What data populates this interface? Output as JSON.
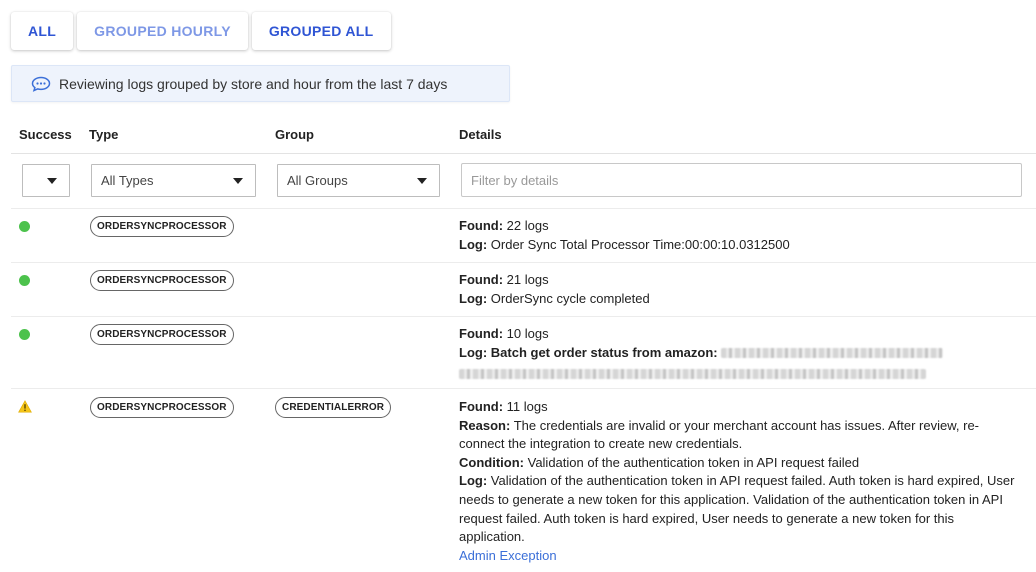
{
  "tabs": [
    {
      "label": "ALL",
      "active": true
    },
    {
      "label": "GROUPED HOURLY",
      "active": false
    },
    {
      "label": "GROUPED ALL",
      "active": true
    }
  ],
  "banner": {
    "icon": "chat-bubble-icon",
    "text": "Reviewing logs grouped by store and hour from the last 7 days"
  },
  "table": {
    "headers": {
      "success": "Success",
      "type": "Type",
      "group": "Group",
      "details": "Details"
    },
    "filters": {
      "success_value": "",
      "type_value": "All Types",
      "group_value": "All Groups",
      "details_placeholder": "Filter by details"
    },
    "rows": [
      {
        "status": "success",
        "type": "ORDERSYNCPROCESSOR",
        "group": "",
        "found_label": "Found:",
        "found": "22 logs",
        "log_label": "Log:",
        "log": "Order Sync Total Processor Time:00:00:10.0312500"
      },
      {
        "status": "success",
        "type": "ORDERSYNCPROCESSOR",
        "group": "",
        "found_label": "Found:",
        "found": "21 logs",
        "log_label": "Log:",
        "log": "OrderSync cycle completed"
      },
      {
        "status": "success",
        "type": "ORDERSYNCPROCESSOR",
        "group": "",
        "found_label": "Found:",
        "found": "10 logs",
        "log_label": "Log:",
        "log": "Batch get order status from amazon:"
      },
      {
        "status": "warning",
        "type": "ORDERSYNCPROCESSOR",
        "group": "CREDENTIALERROR",
        "found_label": "Found:",
        "found": "11 logs",
        "reason_label": "Reason:",
        "reason": "The credentials are invalid or your merchant account has issues. After review, re-connect the integration to create new credentials.",
        "condition_label": "Condition:",
        "condition": "Validation of the authentication token in API request failed",
        "log_label": "Log:",
        "log": "Validation of the authentication token in API request failed. Auth token is hard expired, User needs to generate a new token for this application. Validation of the authentication token in API request failed. Auth token is hard expired, User needs to generate a new token for this application.",
        "link": "Admin Exception"
      }
    ]
  },
  "colors": {
    "accent": "#2f55d4",
    "accent_light": "#7e98e6",
    "success": "#4cc24c",
    "warning": "#f5c518",
    "link": "#3b6fd8"
  }
}
